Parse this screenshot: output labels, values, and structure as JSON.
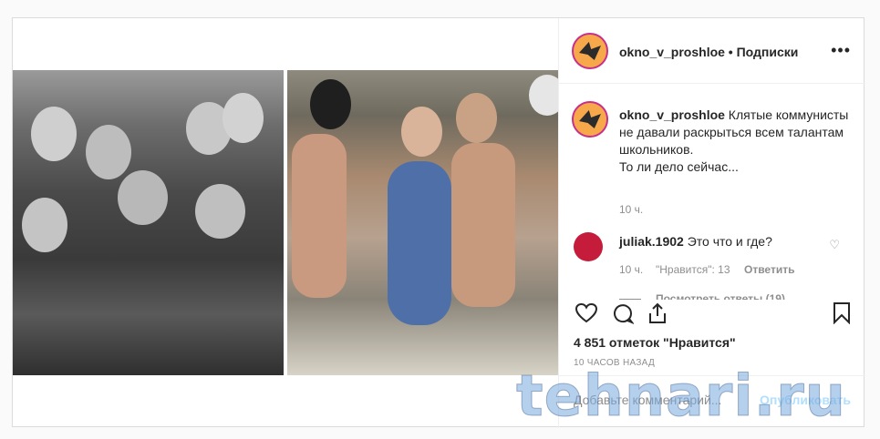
{
  "post": {
    "username": "okno_v_proshloe",
    "separator": " • ",
    "follow_label": "Подписки",
    "more_label": "•••"
  },
  "caption": {
    "username": "okno_v_proshloe",
    "line1": " Клятые коммунисты не давали раскрыться всем талантам школьников.",
    "line2": "То ли дело сейчас...",
    "time": "10 ч."
  },
  "comment": {
    "username": "juliak.1902",
    "text": " Это что и где?",
    "time": "10 ч.",
    "likes": "\"Нравится\": 13",
    "reply": "Ответить",
    "view_replies": "Посмотреть ответы (19)"
  },
  "actions": {
    "likes_count": "4 851 отметок \"Нравится\"",
    "posted_ago": "10 ЧАСОВ НАЗАД"
  },
  "add_comment": {
    "placeholder": "Добавьте комментарий...",
    "publish": "Опубликовать"
  },
  "watermark": "tehnari.ru",
  "colors": {
    "publish": "#b2dffc",
    "meta": "#8e8e8e",
    "avatar_ring": "#c7308a"
  }
}
